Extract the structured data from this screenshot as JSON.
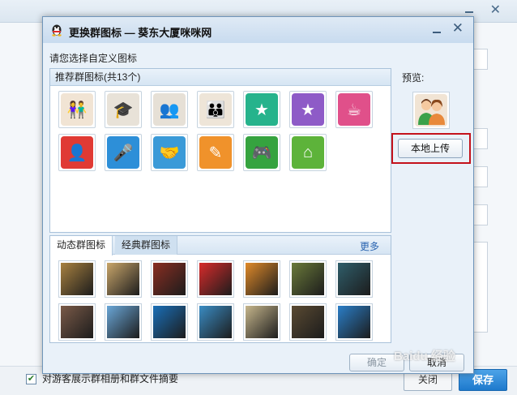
{
  "dialog": {
    "title": "更换群图标 — 葵东大厦咪咪网",
    "instruction": "请您选择自定义图标",
    "recommended_header": "推荐群图标(共13个)",
    "tabs": {
      "dynamic": "动态群图标",
      "classic": "经典群图标",
      "more": "更多"
    },
    "preview_label": "预览:",
    "upload_button": "本地上传",
    "ok_button": "确定",
    "cancel_button": "取消"
  },
  "recommended_icons": [
    {
      "name": "people-couple-icon",
      "color": "#f1e4d4"
    },
    {
      "name": "graduates-icon",
      "color": "#e8e2d8"
    },
    {
      "name": "people-trio-icon",
      "color": "#e6e0d6"
    },
    {
      "name": "people-family-icon",
      "color": "#eee5d8"
    },
    {
      "name": "badge-star-icon",
      "color": "#26b38c"
    },
    {
      "name": "shopping-bag-icon",
      "color": "#8e5bc7"
    },
    {
      "name": "coffee-cup-icon",
      "color": "#e0508a"
    },
    {
      "name": "contacts-icon",
      "color": "#e03a34"
    },
    {
      "name": "microphone-icon",
      "color": "#2d8fd8"
    },
    {
      "name": "handshake-icon",
      "color": "#3a9ad8"
    },
    {
      "name": "pencil-edit-icon",
      "color": "#f0922b"
    },
    {
      "name": "gamepad-icon",
      "color": "#35a33f"
    },
    {
      "name": "home-icon",
      "color": "#5db33a"
    }
  ],
  "dynamic_icons": [
    {
      "name": "golfer-photo-icon",
      "color": "#a88140"
    },
    {
      "name": "car-photo-icon",
      "color": "#c9a66b"
    },
    {
      "name": "red-car-photo-icon",
      "color": "#8a2e22"
    },
    {
      "name": "red-heart-photo-icon",
      "color": "#d82b2b"
    },
    {
      "name": "sunset-palm-photo-icon",
      "color": "#e08a2a"
    },
    {
      "name": "handshake-photo-icon",
      "color": "#6a7a3a"
    },
    {
      "name": "currency-photo-icon",
      "color": "#2f5e6b"
    },
    {
      "name": "hands-coins-photo-icon",
      "color": "#7a5a48"
    },
    {
      "name": "beach-photo-icon",
      "color": "#6aa7d8"
    },
    {
      "name": "blue-curtain-photo-icon",
      "color": "#1a6fb8"
    },
    {
      "name": "globe-tree-photo-icon",
      "color": "#3a8cc4"
    },
    {
      "name": "signpost-photo-icon",
      "color": "#c6b68c"
    },
    {
      "name": "pocket-watch-photo-icon",
      "color": "#5a4a32"
    },
    {
      "name": "cyclist-photo-icon",
      "color": "#2a7ec8"
    }
  ],
  "background": {
    "checkbox_label": "对游客展示群相册和群文件摘要",
    "close_button": "关闭",
    "save_button": "保存",
    "watermark": "Baidu 经验"
  }
}
